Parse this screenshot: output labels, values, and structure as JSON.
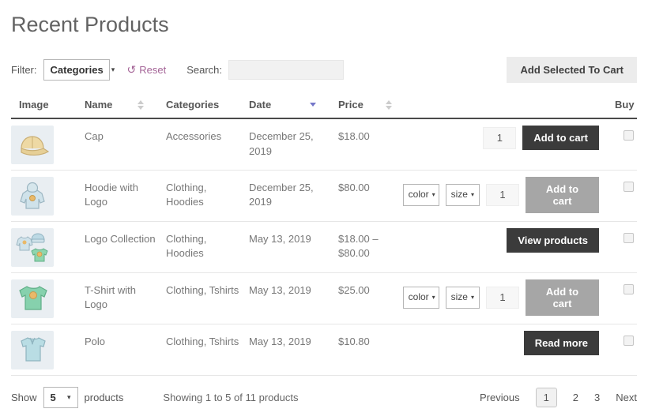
{
  "page": {
    "title": "Recent Products"
  },
  "icons": {
    "reset": "↺",
    "select_arrow": "▾"
  },
  "colors": {
    "accent_purple": "#a46497",
    "dark_button": "#3b3b3b",
    "disabled_button": "#a6a6a6",
    "sort_active": "#7577c9",
    "thumb_background": "#e9eef2"
  },
  "toolbar": {
    "filter_label": "Filter:",
    "filter_value": "Categories",
    "reset_label": "Reset",
    "search_label": "Search:",
    "search_value": "",
    "add_selected_label": "Add Selected To Cart"
  },
  "table": {
    "headers": {
      "image": "Image",
      "name": "Name",
      "categories": "Categories",
      "date": "Date",
      "price": "Price",
      "buy": "Buy"
    },
    "sorted_column": "Date",
    "sort_direction": "descending"
  },
  "rows": [
    {
      "name": "Cap",
      "categories": "Accessories",
      "date": "December 25, 2019",
      "price": "$18.00",
      "qty": "1",
      "button": "Add to cart",
      "button_state": "enabled",
      "image": "cap"
    },
    {
      "name": "Hoodie with Logo",
      "categories": "Clothing, Hoodies",
      "date": "December 25, 2019",
      "price": "$80.00",
      "color_label": "color",
      "size_label": "size",
      "qty": "1",
      "button": "Add to cart",
      "button_state": "disabled",
      "image": "hoodie"
    },
    {
      "name": "Logo Collection",
      "categories": "Clothing, Hoodies",
      "date": "May 13, 2019",
      "price": "$18.00 – $80.00",
      "button": "View products",
      "button_state": "enabled",
      "image": "collection"
    },
    {
      "name": "T-Shirt with Logo",
      "categories": "Clothing, Tshirts",
      "date": "May 13, 2019",
      "price": "$25.00",
      "color_label": "color",
      "size_label": "size",
      "qty": "1",
      "button": "Add to cart",
      "button_state": "disabled",
      "image": "tshirt"
    },
    {
      "name": "Polo",
      "categories": "Clothing, Tshirts",
      "date": "May 13, 2019",
      "price": "$10.80",
      "button": "Read more",
      "button_state": "enabled",
      "image": "polo"
    }
  ],
  "footer": {
    "show_label": "Show",
    "show_value": "5",
    "products_label": "products",
    "summary": "Showing 1 to 5 of 11 products",
    "pagination": {
      "previous": "Previous",
      "pages": [
        "1",
        "2",
        "3"
      ],
      "current": "1",
      "next": "Next"
    }
  }
}
